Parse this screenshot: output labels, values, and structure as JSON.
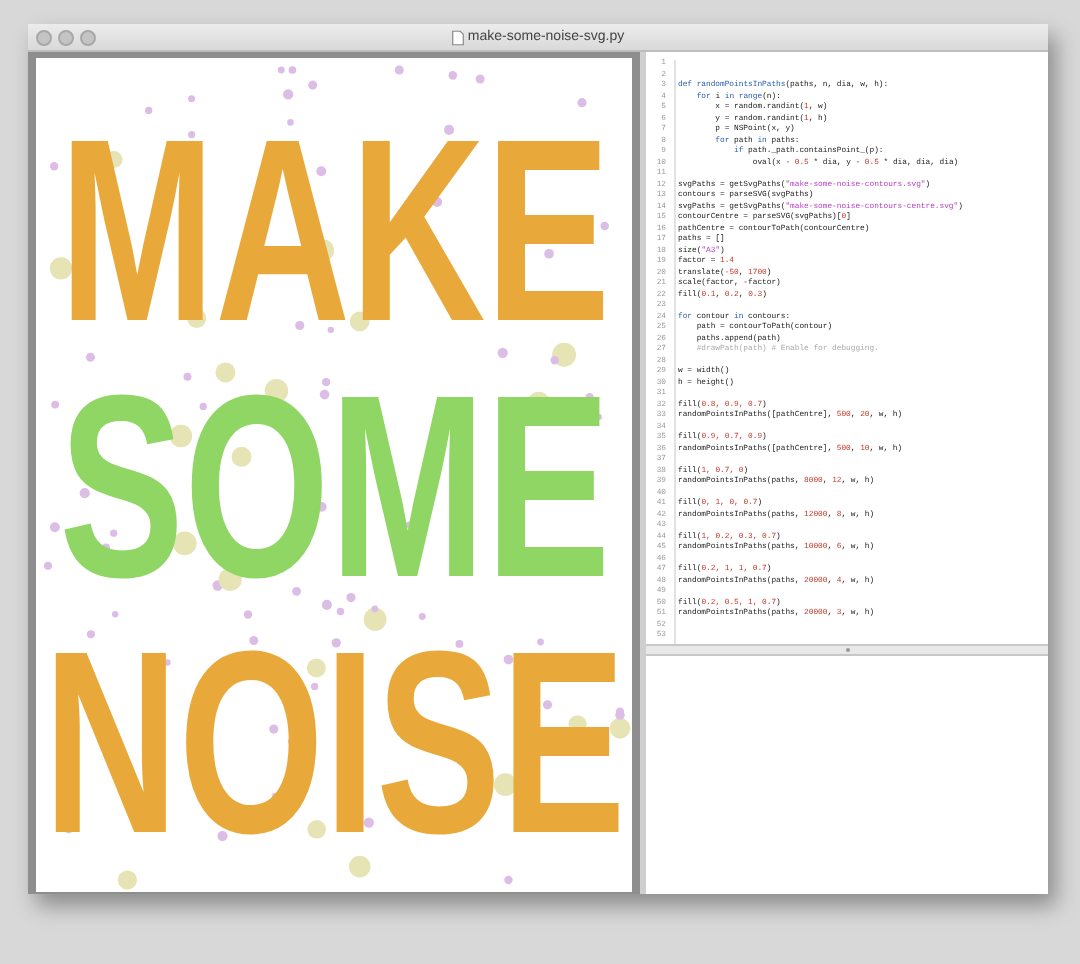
{
  "window": {
    "title": "make-some-noise-svg.py"
  },
  "canvas": {
    "lines": [
      "MAKE",
      "SOME",
      "NOISE"
    ]
  },
  "editor": {
    "lines": [
      {
        "number": "1"
      },
      {
        "number": "2"
      },
      {
        "number": "3",
        "segments": [
          {
            "text": "def ",
            "kind": "keyword"
          },
          {
            "text": "randomPointsInPaths",
            "kind": "name"
          },
          {
            "text": "(paths, n, dia, w, h):",
            "kind": "plain"
          }
        ]
      },
      {
        "number": "4",
        "segments": [
          {
            "text": "    for ",
            "kind": "keyword"
          },
          {
            "text": "i ",
            "kind": "plain"
          },
          {
            "text": "in ",
            "kind": "keyword"
          },
          {
            "text": "range",
            "kind": "name"
          },
          {
            "text": "(n):",
            "kind": "plain"
          }
        ]
      },
      {
        "number": "5",
        "segments": [
          {
            "text": "        x = random.randint(",
            "kind": "plain"
          },
          {
            "text": "1",
            "kind": "number"
          },
          {
            "text": ", w)",
            "kind": "plain"
          }
        ]
      },
      {
        "number": "6",
        "segments": [
          {
            "text": "        y = random.randint(",
            "kind": "plain"
          },
          {
            "text": "1",
            "kind": "number"
          },
          {
            "text": ", h)",
            "kind": "plain"
          }
        ]
      },
      {
        "number": "7",
        "segments": [
          {
            "text": "        p = NSPoint(x, y)",
            "kind": "plain"
          }
        ]
      },
      {
        "number": "8",
        "segments": [
          {
            "text": "        for ",
            "kind": "keyword"
          },
          {
            "text": "path ",
            "kind": "plain"
          },
          {
            "text": "in ",
            "kind": "keyword"
          },
          {
            "text": "paths:",
            "kind": "plain"
          }
        ]
      },
      {
        "number": "9",
        "segments": [
          {
            "text": "            if ",
            "kind": "keyword"
          },
          {
            "text": "path._path.containsPoint_(p):",
            "kind": "plain"
          }
        ]
      },
      {
        "number": "10",
        "segments": [
          {
            "text": "                oval(x - ",
            "kind": "plain"
          },
          {
            "text": "0.5",
            "kind": "number"
          },
          {
            "text": " * dia, y - ",
            "kind": "plain"
          },
          {
            "text": "0.5",
            "kind": "number"
          },
          {
            "text": " * dia, dia, dia)",
            "kind": "plain"
          }
        ]
      },
      {
        "number": "11"
      },
      {
        "number": "12",
        "segments": [
          {
            "text": "svgPaths = getSvgPaths(",
            "kind": "plain"
          },
          {
            "text": "\"make-some-noise-contours.svg\"",
            "kind": "string"
          },
          {
            "text": ")",
            "kind": "plain"
          }
        ]
      },
      {
        "number": "13",
        "segments": [
          {
            "text": "contours = parseSVG(svgPaths)",
            "kind": "plain"
          }
        ]
      },
      {
        "number": "14",
        "segments": [
          {
            "text": "svgPaths = getSvgPaths(",
            "kind": "plain"
          },
          {
            "text": "\"make-some-noise-contours-centre.svg\"",
            "kind": "string"
          },
          {
            "text": ")",
            "kind": "plain"
          }
        ]
      },
      {
        "number": "15",
        "segments": [
          {
            "text": "contourCentre = parseSVG(svgPaths)[",
            "kind": "plain"
          },
          {
            "text": "0",
            "kind": "number"
          },
          {
            "text": "]",
            "kind": "plain"
          }
        ]
      },
      {
        "number": "16",
        "segments": [
          {
            "text": "pathCentre = contourToPath(contourCentre)",
            "kind": "plain"
          }
        ]
      },
      {
        "number": "17",
        "segments": [
          {
            "text": "paths = []",
            "kind": "plain"
          }
        ]
      },
      {
        "number": "18",
        "segments": [
          {
            "text": "size(",
            "kind": "plain"
          },
          {
            "text": "\"A3\"",
            "kind": "string"
          },
          {
            "text": ")",
            "kind": "plain"
          }
        ]
      },
      {
        "number": "19",
        "segments": [
          {
            "text": "factor = ",
            "kind": "plain"
          },
          {
            "text": "1.4",
            "kind": "number"
          }
        ]
      },
      {
        "number": "20",
        "segments": [
          {
            "text": "translate(",
            "kind": "plain"
          },
          {
            "text": "-50",
            "kind": "number"
          },
          {
            "text": ", ",
            "kind": "plain"
          },
          {
            "text": "1700",
            "kind": "number"
          },
          {
            "text": ")",
            "kind": "plain"
          }
        ]
      },
      {
        "number": "21",
        "segments": [
          {
            "text": "scale(factor, -factor)",
            "kind": "plain"
          }
        ]
      },
      {
        "number": "22",
        "segments": [
          {
            "text": "fill(",
            "kind": "plain"
          },
          {
            "text": "0.1",
            "kind": "number"
          },
          {
            "text": ", ",
            "kind": "plain"
          },
          {
            "text": "0.2",
            "kind": "number"
          },
          {
            "text": ", ",
            "kind": "plain"
          },
          {
            "text": "0.3",
            "kind": "number"
          },
          {
            "text": ")",
            "kind": "plain"
          }
        ]
      },
      {
        "number": "23"
      },
      {
        "number": "24",
        "segments": [
          {
            "text": "for ",
            "kind": "keyword"
          },
          {
            "text": "contour ",
            "kind": "plain"
          },
          {
            "text": "in ",
            "kind": "keyword"
          },
          {
            "text": "contours:",
            "kind": "plain"
          }
        ]
      },
      {
        "number": "25",
        "segments": [
          {
            "text": "    path = contourToPath(contour)",
            "kind": "plain"
          }
        ]
      },
      {
        "number": "26",
        "segments": [
          {
            "text": "    paths.append(path)",
            "kind": "plain"
          }
        ]
      },
      {
        "number": "27",
        "segments": [
          {
            "text": "    #drawPath(path) # Enable for debugging.",
            "kind": "comment"
          }
        ]
      },
      {
        "number": "28"
      },
      {
        "number": "29",
        "segments": [
          {
            "text": "w = width()",
            "kind": "plain"
          }
        ]
      },
      {
        "number": "30",
        "segments": [
          {
            "text": "h = height()",
            "kind": "plain"
          }
        ]
      },
      {
        "number": "31"
      },
      {
        "number": "32",
        "segments": [
          {
            "text": "fill(",
            "kind": "plain"
          },
          {
            "text": "0.8, 0.9, 0.7",
            "kind": "number"
          },
          {
            "text": ")",
            "kind": "plain"
          }
        ]
      },
      {
        "number": "33",
        "segments": [
          {
            "text": "randomPointsInPaths([pathCentre], ",
            "kind": "plain"
          },
          {
            "text": "500",
            "kind": "number"
          },
          {
            "text": ", ",
            "kind": "plain"
          },
          {
            "text": "20",
            "kind": "number"
          },
          {
            "text": ", w, h)",
            "kind": "plain"
          }
        ]
      },
      {
        "number": "34"
      },
      {
        "number": "35",
        "segments": [
          {
            "text": "fill(",
            "kind": "plain"
          },
          {
            "text": "0.9, 0.7, 0.9",
            "kind": "number"
          },
          {
            "text": ")",
            "kind": "plain"
          }
        ]
      },
      {
        "number": "36",
        "segments": [
          {
            "text": "randomPointsInPaths([pathCentre], ",
            "kind": "plain"
          },
          {
            "text": "500",
            "kind": "number"
          },
          {
            "text": ", ",
            "kind": "plain"
          },
          {
            "text": "10",
            "kind": "number"
          },
          {
            "text": ", w, h)",
            "kind": "plain"
          }
        ]
      },
      {
        "number": "37"
      },
      {
        "number": "38",
        "segments": [
          {
            "text": "fill(",
            "kind": "plain"
          },
          {
            "text": "1, 0.7, 0",
            "kind": "number"
          },
          {
            "text": ")",
            "kind": "plain"
          }
        ]
      },
      {
        "number": "39",
        "segments": [
          {
            "text": "randomPointsInPaths(paths, ",
            "kind": "plain"
          },
          {
            "text": "8000",
            "kind": "number"
          },
          {
            "text": ", ",
            "kind": "plain"
          },
          {
            "text": "12",
            "kind": "number"
          },
          {
            "text": ", w, h)",
            "kind": "plain"
          }
        ]
      },
      {
        "number": "40"
      },
      {
        "number": "41",
        "segments": [
          {
            "text": "fill(",
            "kind": "plain"
          },
          {
            "text": "0, 1, 0, 0.7",
            "kind": "number"
          },
          {
            "text": ")",
            "kind": "plain"
          }
        ]
      },
      {
        "number": "42",
        "segments": [
          {
            "text": "randomPointsInPaths(paths, ",
            "kind": "plain"
          },
          {
            "text": "12000",
            "kind": "number"
          },
          {
            "text": ", ",
            "kind": "plain"
          },
          {
            "text": "8",
            "kind": "number"
          },
          {
            "text": ", w, h)",
            "kind": "plain"
          }
        ]
      },
      {
        "number": "43"
      },
      {
        "number": "44",
        "segments": [
          {
            "text": "fill(",
            "kind": "plain"
          },
          {
            "text": "1, 0.2, 0.3, 0.7",
            "kind": "number"
          },
          {
            "text": ")",
            "kind": "plain"
          }
        ]
      },
      {
        "number": "45",
        "segments": [
          {
            "text": "randomPointsInPaths(paths, ",
            "kind": "plain"
          },
          {
            "text": "10000",
            "kind": "number"
          },
          {
            "text": ", ",
            "kind": "plain"
          },
          {
            "text": "6",
            "kind": "number"
          },
          {
            "text": ", w, h)",
            "kind": "plain"
          }
        ]
      },
      {
        "number": "46"
      },
      {
        "number": "47",
        "segments": [
          {
            "text": "fill(",
            "kind": "plain"
          },
          {
            "text": "0.2, 1, 1, 0.7",
            "kind": "number"
          },
          {
            "text": ")",
            "kind": "plain"
          }
        ]
      },
      {
        "number": "48",
        "segments": [
          {
            "text": "randomPointsInPaths(paths, ",
            "kind": "plain"
          },
          {
            "text": "20000",
            "kind": "number"
          },
          {
            "text": ", ",
            "kind": "plain"
          },
          {
            "text": "4",
            "kind": "number"
          },
          {
            "text": ", w, h)",
            "kind": "plain"
          }
        ]
      },
      {
        "number": "49"
      },
      {
        "number": "50",
        "segments": [
          {
            "text": "fill(",
            "kind": "plain"
          },
          {
            "text": "0.2, 0.5, 1, 0.7",
            "kind": "number"
          },
          {
            "text": ")",
            "kind": "plain"
          }
        ]
      },
      {
        "number": "51",
        "segments": [
          {
            "text": "randomPointsInPaths(paths, ",
            "kind": "plain"
          },
          {
            "text": "20000",
            "kind": "number"
          },
          {
            "text": ", ",
            "kind": "plain"
          },
          {
            "text": "3",
            "kind": "number"
          },
          {
            "text": ", w, h)",
            "kind": "plain"
          }
        ]
      },
      {
        "number": "52"
      },
      {
        "number": "53"
      }
    ]
  }
}
